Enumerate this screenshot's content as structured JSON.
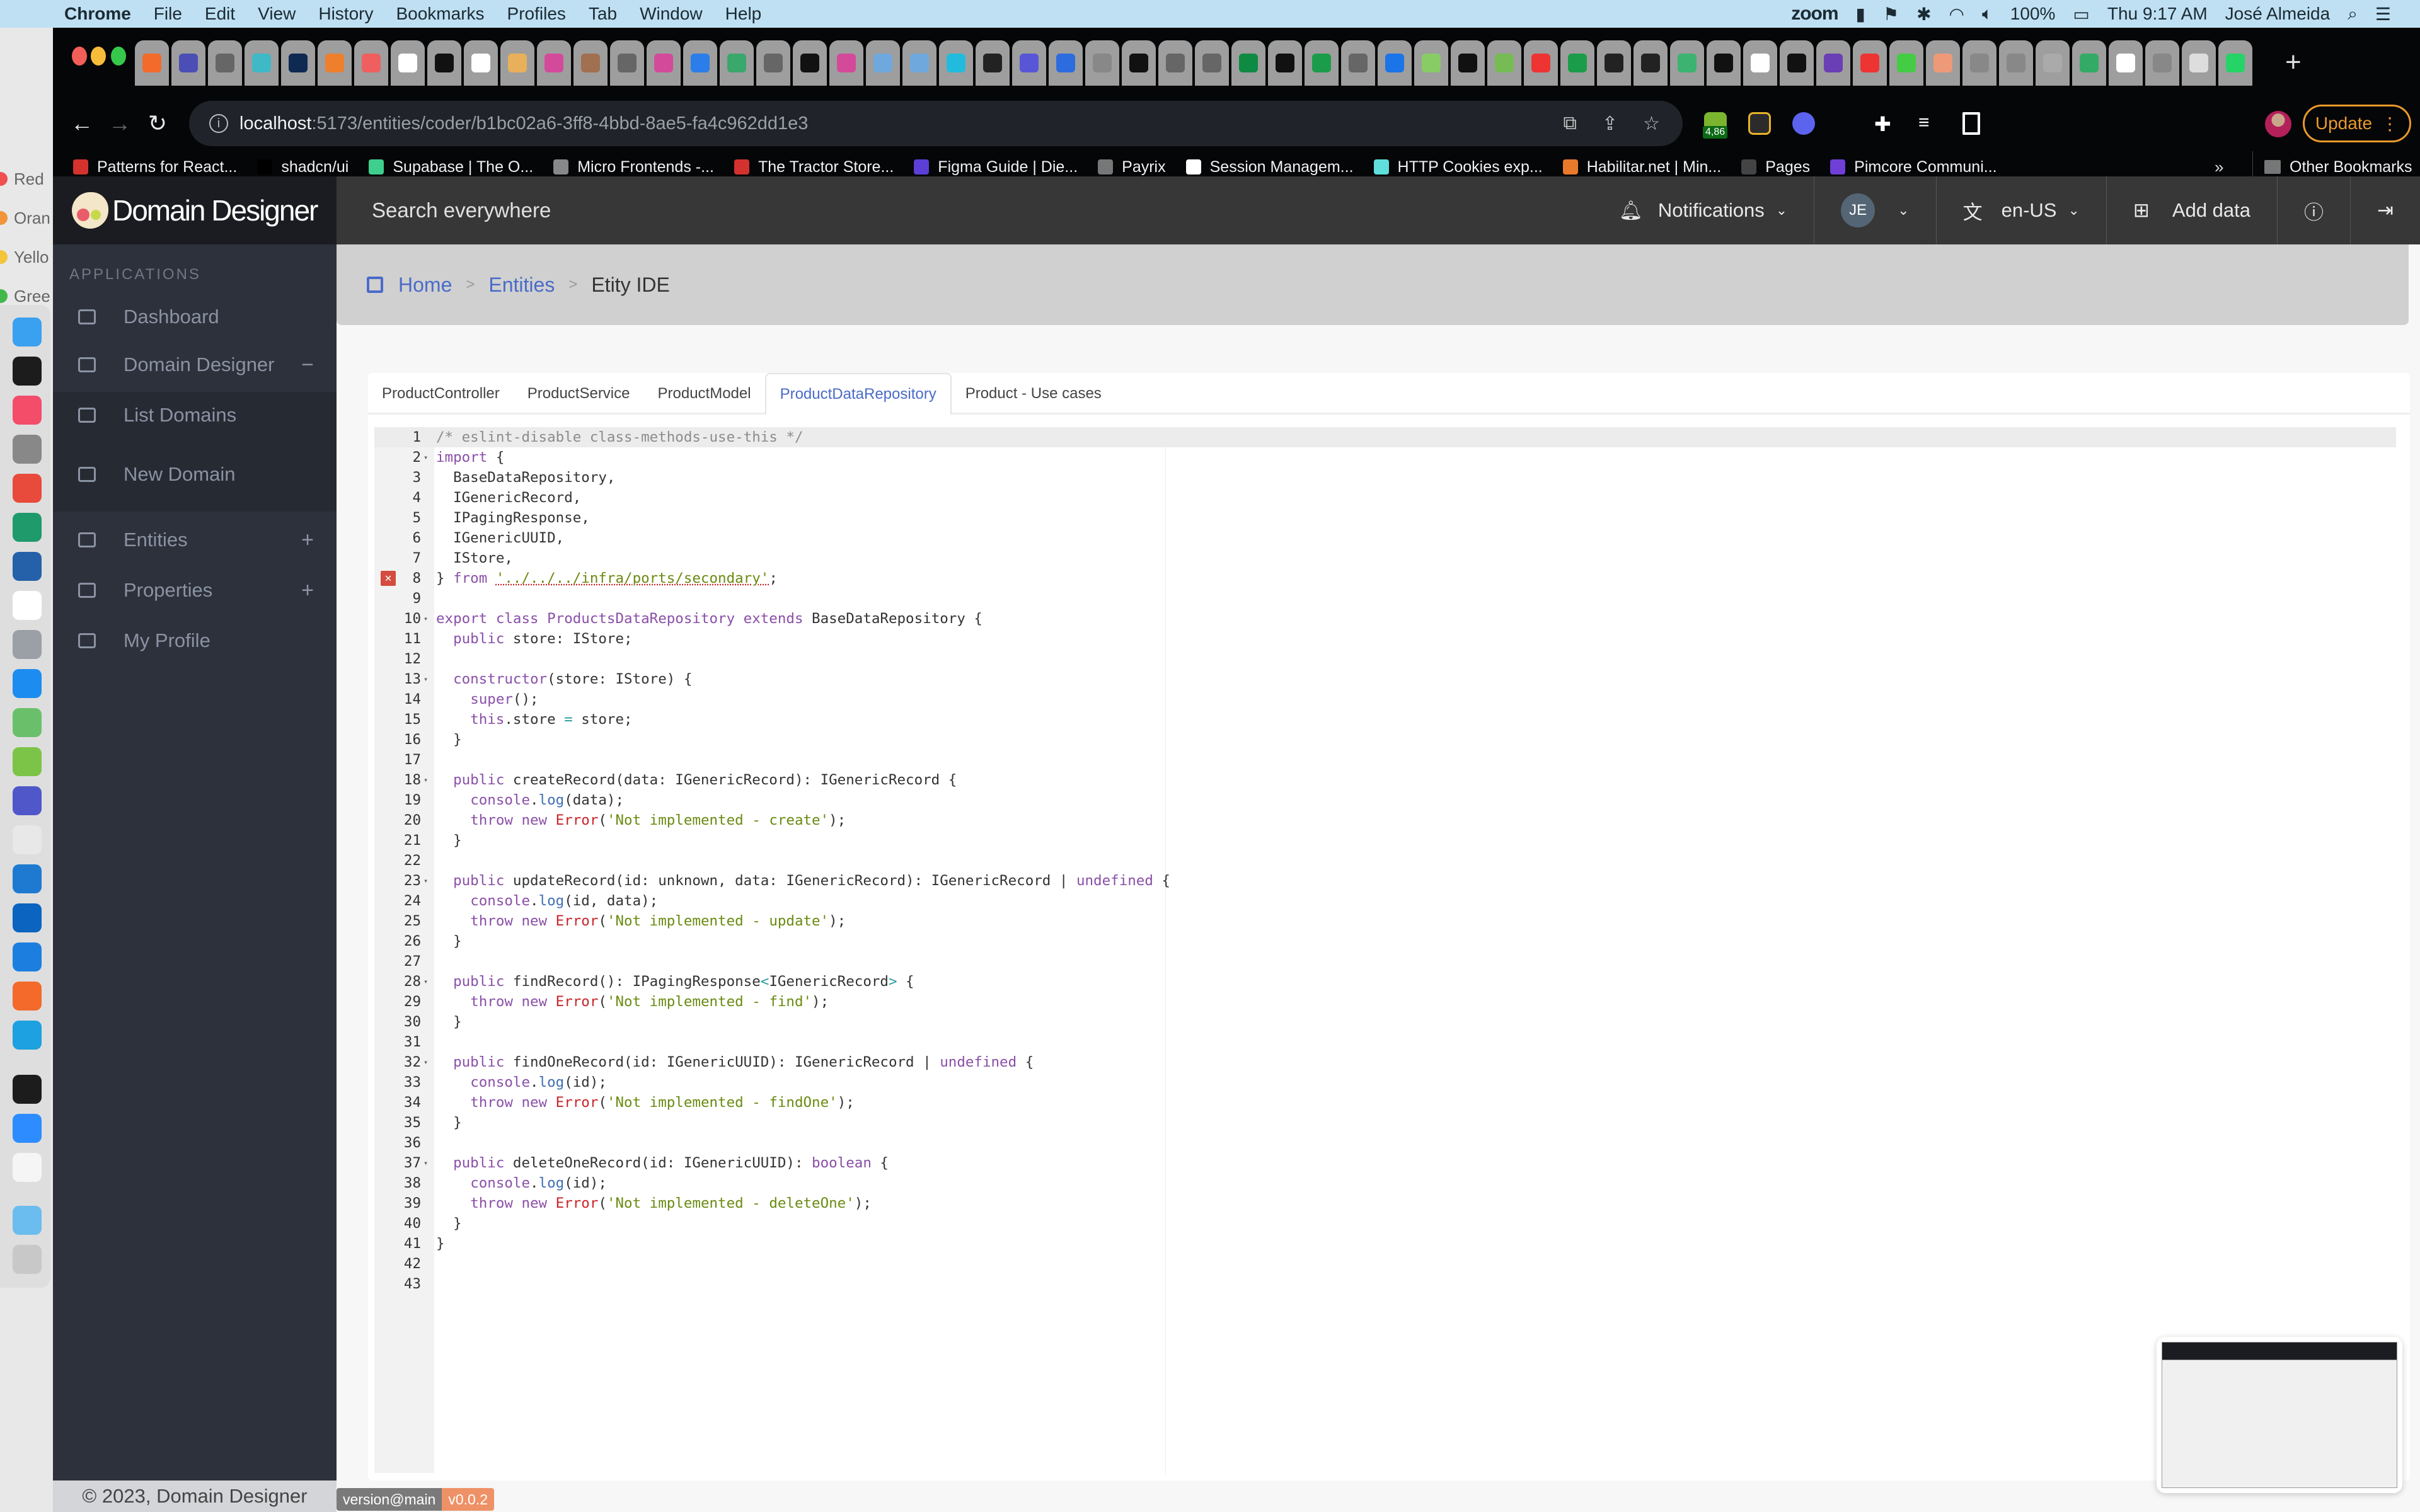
{
  "menubar": {
    "app_name": "Chrome",
    "items": [
      "File",
      "Edit",
      "View",
      "History",
      "Bookmarks",
      "Profiles",
      "Tab",
      "Window",
      "Help"
    ],
    "status": {
      "zoom": "zoom",
      "battery": "100%",
      "clock": "Thu 9:17 AM",
      "user": "José Almeida"
    }
  },
  "desktop_tags": [
    "Red",
    "Oran",
    "Yello",
    "Gree"
  ],
  "browser": {
    "url_host": "localhost",
    "url_path": ":5173/entities/coder/b1bc02a6-3ff8-4bbd-8ae5-fa4c962dd1e3",
    "extension_badge": "4,86",
    "update_label": "Update",
    "bookmarks": [
      {
        "label": "Patterns for React...",
        "color": "#d4322e"
      },
      {
        "label": "shadcn/ui",
        "color": "#000000"
      },
      {
        "label": "Supabase | The O...",
        "color": "#3ecf8e"
      },
      {
        "label": "Micro Frontends -...",
        "color": "#888888"
      },
      {
        "label": "The Tractor Store...",
        "color": "#d4322e"
      },
      {
        "label": "Figma Guide | Die...",
        "color": "#5b3fd6"
      },
      {
        "label": "Payrix",
        "color": "#777777"
      },
      {
        "label": "Session Managem...",
        "color": "#ffffff"
      },
      {
        "label": "HTTP Cookies exp...",
        "color": "#5fe0dc"
      },
      {
        "label": "Habilitar.net | Min...",
        "color": "#e97a2b"
      },
      {
        "label": "Pages",
        "color": "#444444"
      },
      {
        "label": "Pimcore Communi...",
        "color": "#6f3fd6"
      }
    ],
    "bookmarks_more": "»",
    "other_bookmarks": "Other Bookmarks"
  },
  "app": {
    "brand": "Domain Designer",
    "search_placeholder": "Search everywhere",
    "notifications_label": "Notifications",
    "user_initials": "JE",
    "language": "en-US",
    "add_data_label": "Add data",
    "sidebar": {
      "section": "APPLICATIONS",
      "items": [
        {
          "label": "Dashboard",
          "toggle": ""
        },
        {
          "label": "Domain Designer",
          "toggle": "−"
        },
        {
          "label": "List Domains",
          "toggle": ""
        },
        {
          "label": "New Domain",
          "toggle": ""
        },
        {
          "label": "Entities",
          "toggle": "+"
        },
        {
          "label": "Properties",
          "toggle": "+"
        },
        {
          "label": "My Profile",
          "toggle": ""
        }
      ]
    },
    "breadcrumb": [
      {
        "label": "Home"
      },
      {
        "label": "Entities"
      },
      {
        "label": "Etity IDE"
      }
    ],
    "file_tabs": [
      {
        "label": "ProductController",
        "active": false
      },
      {
        "label": "ProductService",
        "active": false
      },
      {
        "label": "ProductModel",
        "active": false
      },
      {
        "label": "ProductDataRepository",
        "active": true
      },
      {
        "label": "Product - Use cases",
        "active": false
      }
    ],
    "editor": {
      "active_line": 1,
      "error_line": 8,
      "fold_lines": [
        2,
        10,
        13,
        18,
        23,
        28,
        32,
        37
      ],
      "lines": [
        "/* eslint-disable class-methods-use-this */",
        "import {",
        "  BaseDataRepository,",
        "  IGenericRecord,",
        "  IPagingResponse,",
        "  IGenericUUID,",
        "  IStore,",
        "} from '../../../infra/ports/secondary';",
        "",
        "export class ProductsDataRepository extends BaseDataRepository {",
        "  public store: IStore;",
        "",
        "  constructor(store: IStore) {",
        "    super();",
        "    this.store = store;",
        "  }",
        "",
        "  public createRecord(data: IGenericRecord): IGenericRecord {",
        "    console.log(data);",
        "    throw new Error('Not implemented - create');",
        "  }",
        "",
        "  public updateRecord(id: unknown, data: IGenericRecord): IGenericRecord | undefined {",
        "    console.log(id, data);",
        "    throw new Error('Not implemented - update');",
        "  }",
        "",
        "  public findRecord(): IPagingResponse<IGenericRecord> {",
        "    throw new Error('Not implemented - find');",
        "  }",
        "",
        "  public findOneRecord(id: IGenericUUID): IGenericRecord | undefined {",
        "    console.log(id);",
        "    throw new Error('Not implemented - findOne');",
        "  }",
        "",
        "  public deleteOneRecord(id: IGenericUUID): boolean {",
        "    console.log(id);",
        "    throw new Error('Not implemented - deleteOne');",
        "  }",
        "}",
        "",
        ""
      ]
    },
    "footer": {
      "copyright": "© 2023, Domain Designer",
      "version_label": "version@main",
      "version_value": "v0.0.2"
    }
  },
  "colors": {
    "accent": "#4a6bc9",
    "sidebar_bg": "#2d313b",
    "topbar_bg": "#373737",
    "keyword": "#8a4fa8",
    "string": "#6a8a10",
    "error_class": "#c9242a",
    "update_orange": "#e99a2b",
    "version_orange": "#ee9166"
  }
}
